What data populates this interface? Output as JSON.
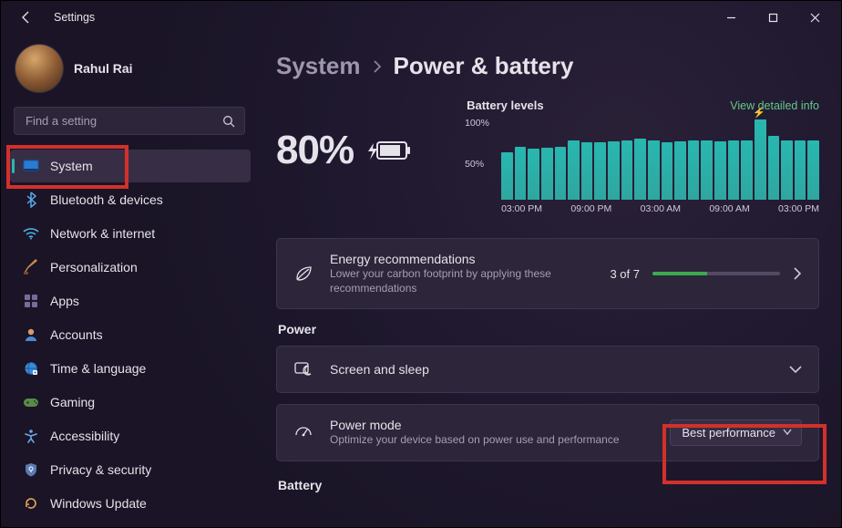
{
  "titlebar": {
    "back": "←",
    "title": "Settings"
  },
  "profile": {
    "name": "Rahul Rai",
    "sub": "                         "
  },
  "search": {
    "placeholder": "Find a setting"
  },
  "sidebar": {
    "items": [
      {
        "label": "System",
        "icon": "system",
        "selected": true
      },
      {
        "label": "Bluetooth & devices",
        "icon": "bluetooth"
      },
      {
        "label": "Network & internet",
        "icon": "wifi"
      },
      {
        "label": "Personalization",
        "icon": "brush"
      },
      {
        "label": "Apps",
        "icon": "apps"
      },
      {
        "label": "Accounts",
        "icon": "person"
      },
      {
        "label": "Time & language",
        "icon": "globe"
      },
      {
        "label": "Gaming",
        "icon": "gamepad"
      },
      {
        "label": "Accessibility",
        "icon": "accessibility"
      },
      {
        "label": "Privacy & security",
        "icon": "shield"
      },
      {
        "label": "Windows Update",
        "icon": "update"
      }
    ]
  },
  "breadcrumb": {
    "a": "System",
    "b": "Power & battery"
  },
  "battery": {
    "percent": "80%",
    "chart_title": "Battery levels",
    "view_link": "View detailed info",
    "y100": "100%",
    "y50": "50%",
    "x": [
      "03:00 PM",
      "09:00 PM",
      "03:00 AM",
      "09:00 AM",
      "03:00 PM"
    ]
  },
  "chart_data": {
    "type": "bar",
    "title": "Battery levels",
    "ylabel": "",
    "xlabel": "",
    "ylim": [
      0,
      100
    ],
    "x_start": "03:00 PM",
    "x_end": "03:00 PM",
    "x_ticks": [
      "03:00 PM",
      "09:00 PM",
      "03:00 AM",
      "09:00 AM",
      "03:00 PM"
    ],
    "values": [
      58,
      64,
      62,
      63,
      64,
      72,
      70,
      70,
      71,
      72,
      74,
      72,
      70,
      71,
      72,
      72,
      71,
      72,
      72,
      98,
      78,
      72,
      72,
      72
    ],
    "spike_index": 19
  },
  "energy": {
    "title": "Energy recommendations",
    "sub": "Lower your carbon footprint by applying these recommendations",
    "count": "3 of 7",
    "progress_pct": 43
  },
  "sections": {
    "power": "Power",
    "battery": "Battery"
  },
  "screen_sleep": {
    "title": "Screen and sleep"
  },
  "power_mode": {
    "title": "Power mode",
    "sub": "Optimize your device based on power use and performance",
    "value": "Best performance"
  }
}
